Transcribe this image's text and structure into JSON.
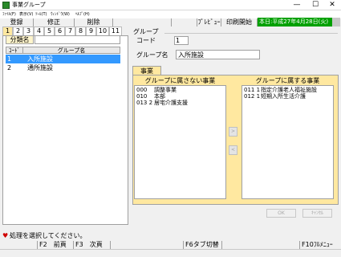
{
  "window": {
    "title": "事業グループ",
    "minimize": "—",
    "maximize": "☐",
    "close": "✕"
  },
  "menu": [
    "ﾌｧｲﾙ(F)",
    "表示(V)",
    "ﾂｰﾙ(T)",
    "ｳｨﾝﾄﾞｳ(W)",
    "ﾍﾙﾌﾟ(H)"
  ],
  "toolbar": {
    "register": "登録",
    "modify": "修正",
    "delete": "削除",
    "preview": "ﾌﾟﾚﾋﾞｭｰ",
    "print": "印刷開始",
    "date": "本日:平成27年4月28日(火)"
  },
  "left_tabs": [
    "1",
    "2",
    "3",
    "4",
    "5",
    "6",
    "7",
    "8",
    "9",
    "10",
    "11"
  ],
  "left_panel": {
    "bunrui_label": "分類名",
    "bunrui_value": "",
    "columns": {
      "code": "ｺｰﾄﾞ",
      "name": "グループ名"
    },
    "rows": [
      {
        "code": "1",
        "name": "入所施設",
        "selected": true
      },
      {
        "code": "2",
        "name": "通所施設",
        "selected": false
      }
    ]
  },
  "group": {
    "section_label": "グループ",
    "code_label": "コード",
    "code_value": "1",
    "name_label": "グループ名",
    "name_value": "入所施設"
  },
  "jigyo": {
    "tab_label": "事業",
    "not_belong_header": "グループに属さない事業",
    "belong_header": "グループに属する事業",
    "not_belong": [
      {
        "code": "000",
        "name": "調整事業"
      },
      {
        "code": "010",
        "name": "本部"
      },
      {
        "code": "013 2",
        "name": "居宅介護支援"
      }
    ],
    "belong": [
      {
        "code": "011 1",
        "name": "指定介護老人福祉施設"
      },
      {
        "code": "012 1",
        "name": "短期入所生活介護"
      }
    ],
    "move_right": ">",
    "move_left": "<",
    "ok": "OK",
    "cancel": "ｷｬﾝｾﾙ"
  },
  "message": {
    "icon": "♥",
    "text": "処理を選択してください。"
  },
  "fkeys": {
    "f2": "F2　前頁",
    "f3": "F3　次頁",
    "f6": "F6タブ切替",
    "f10": "F10ﾌﾙﾒﾆｭｰ"
  },
  "colors": {
    "status_green": "#00a000",
    "selection_blue": "#3399ff",
    "panel_yellow": "#ffe8a0"
  }
}
